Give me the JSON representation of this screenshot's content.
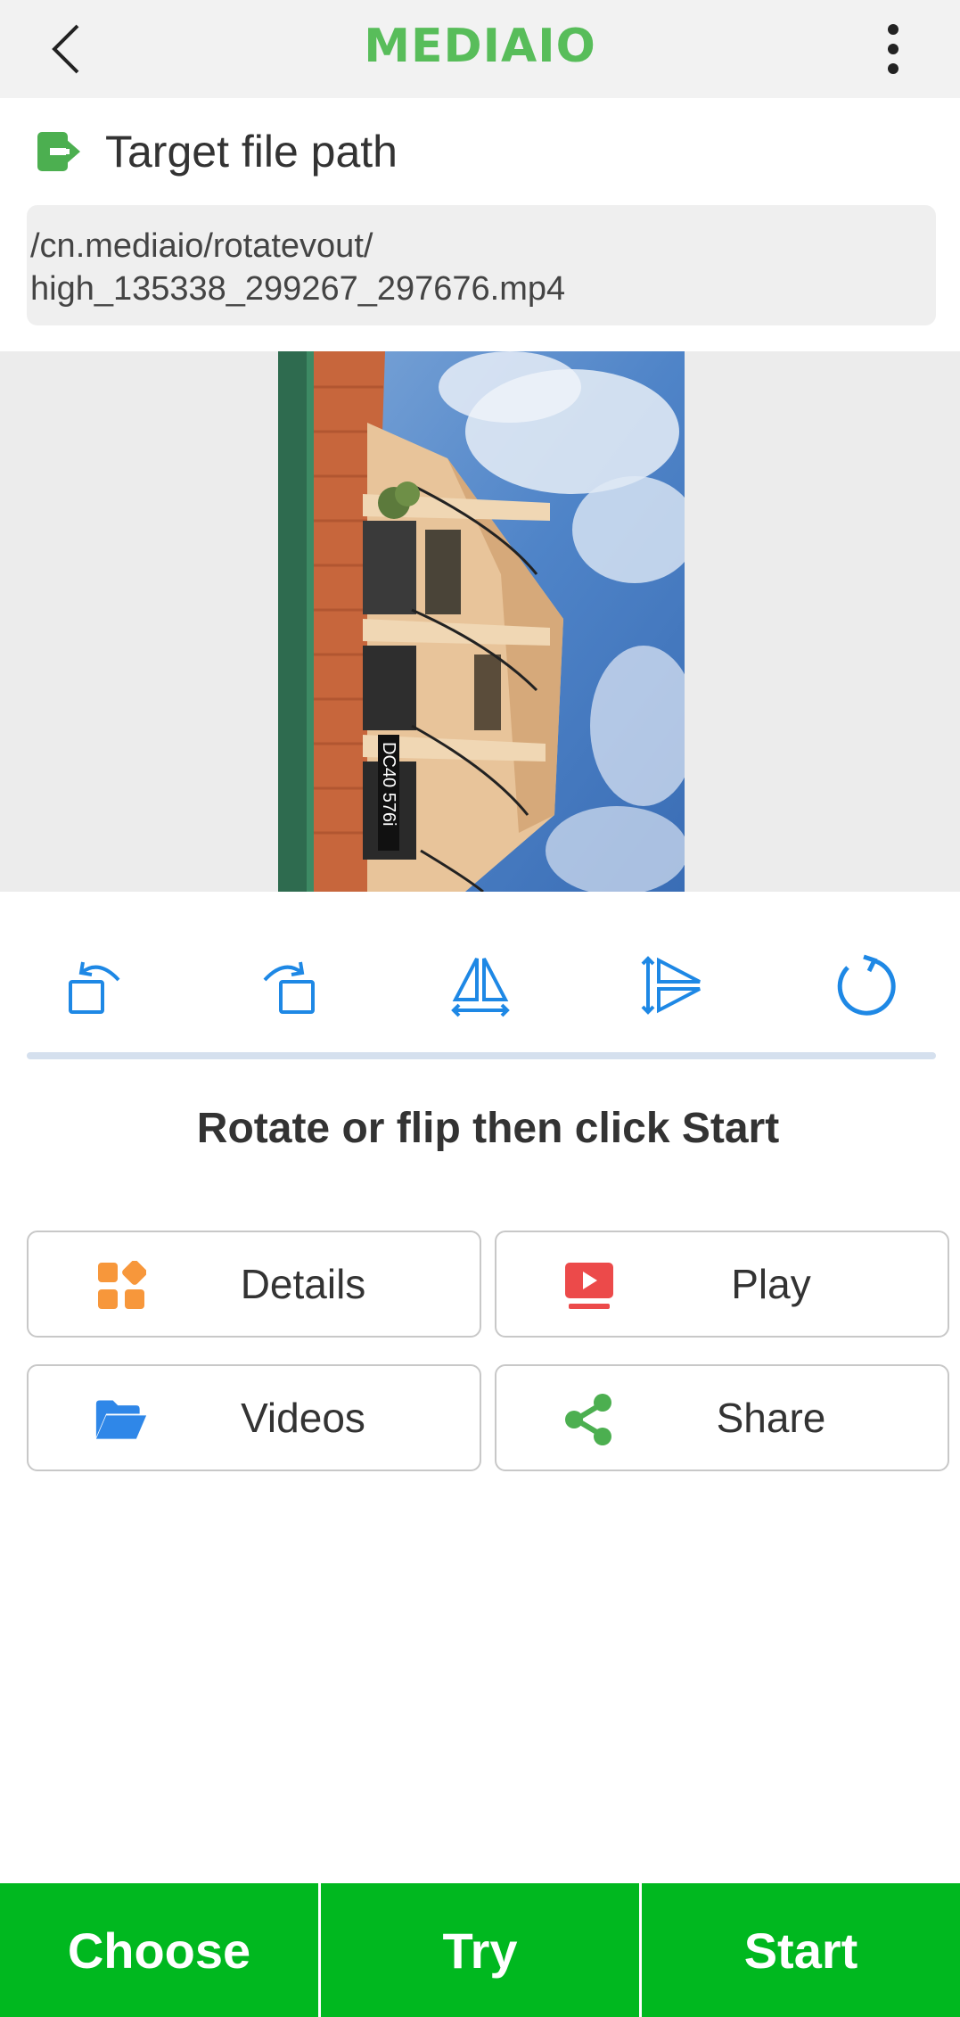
{
  "app": {
    "brand": "MEDIAIO"
  },
  "target": {
    "label": "Target file path",
    "path_line1": "/cn.mediaio/rotatevout/",
    "path_line2": "high_135338_299267_297676.mp4"
  },
  "preview": {
    "overlay_text": "DC40 576i"
  },
  "toolbar": {
    "tools": [
      "rotate-left-icon",
      "rotate-right-icon",
      "flip-horizontal-icon",
      "flip-vertical-icon",
      "reset-rotation-icon"
    ],
    "accent": "#1e88e5"
  },
  "instruction": "Rotate or flip then click Start",
  "actions": {
    "details": "Details",
    "play": "Play",
    "videos": "Videos",
    "share": "Share"
  },
  "bottom": {
    "choose": "Choose",
    "try": "Try",
    "start": "Start"
  },
  "colors": {
    "brand": "#58bd5a",
    "bottom_bar": "#00b81f",
    "details_icon": "#f7973b",
    "play_icon": "#ec4a4a",
    "videos_icon": "#2f87e8",
    "share_icon": "#4caf50"
  }
}
